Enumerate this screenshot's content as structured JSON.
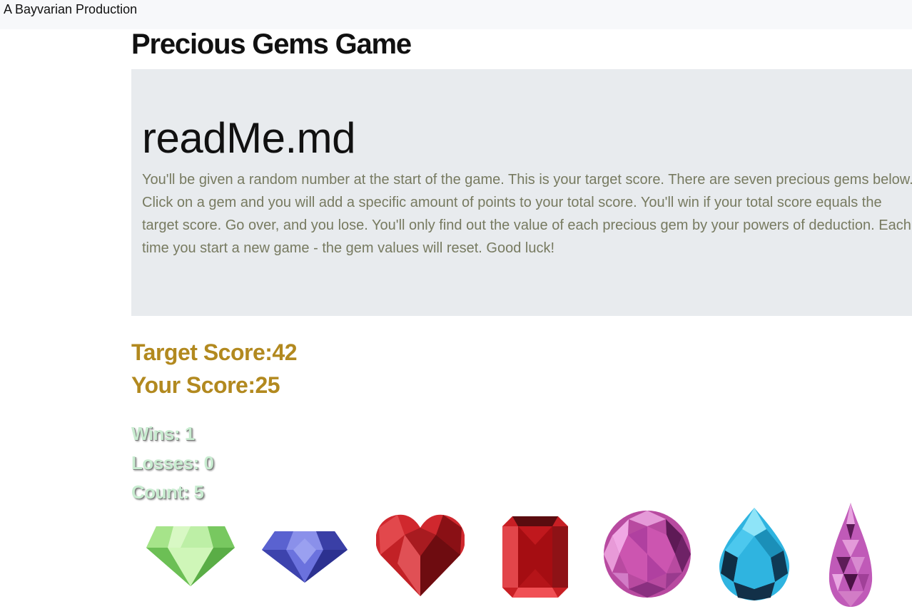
{
  "navbar": {
    "brand": "A Bayvarian Production"
  },
  "page": {
    "title": "Precious Gems Game"
  },
  "readme": {
    "title": "readMe.md",
    "body": "You'll be given a random number at the start of the game. This is your target score. There are seven precious gems below. Click on a gem and you will add a specific amount of points to your total score. You'll win if your total score equals the target score. Go over, and you lose. You'll only find out the value of each precious gem by your powers of deduction. Each time you start a new game - the gem values will reset. Good luck!"
  },
  "scores": {
    "target_label": "Target Score:",
    "target": "42",
    "your_label": "Your Score:",
    "your": "25"
  },
  "stats": {
    "wins_label": "Wins: ",
    "wins": "1",
    "losses_label": "Losses: ",
    "losses": "0",
    "count_label": "Count: ",
    "count": "5"
  },
  "gems": [
    {
      "name": "green-diamond-gem",
      "color": "#8ad870"
    },
    {
      "name": "blue-sapphire-gem",
      "color": "#4a50c0"
    },
    {
      "name": "red-heart-gem",
      "color": "#d0282e"
    },
    {
      "name": "red-emerald-cut-gem",
      "color": "#c81f24"
    },
    {
      "name": "pink-round-gem",
      "color": "#cc55b0"
    },
    {
      "name": "blue-pear-gem",
      "color": "#2fb4e0"
    },
    {
      "name": "pink-teardrop-gem",
      "color": "#c05ab8"
    }
  ]
}
